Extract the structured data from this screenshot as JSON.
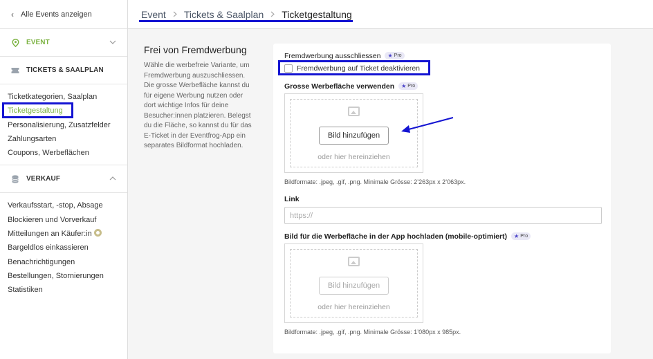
{
  "sidebar": {
    "back_label": "Alle Events anzeigen",
    "sections": {
      "event": {
        "label": "EVENT",
        "color": "#7cb342"
      },
      "tickets": {
        "label": "TICKETS & SAALPLAN",
        "items": [
          {
            "label": "Ticketkategorien, Saalplan"
          },
          {
            "label": "Ticketgestaltung",
            "active": true
          },
          {
            "label": "Personalisierung, Zusatzfelder"
          },
          {
            "label": "Zahlungsarten"
          },
          {
            "label": "Coupons, Werbeflächen"
          }
        ]
      },
      "verkauf": {
        "label": "VERKAUF",
        "items": [
          {
            "label": "Verkaufsstart, -stop, Absage"
          },
          {
            "label": "Blockieren und Vorverkauf"
          },
          {
            "label": "Mitteilungen an Käufer:in",
            "badge_icon": "pro-badge-icon"
          },
          {
            "label": "Bargeldlos einkassieren"
          },
          {
            "label": "Benachrichtigungen"
          },
          {
            "label": "Bestellungen, Stornierungen"
          },
          {
            "label": "Statistiken"
          }
        ]
      }
    }
  },
  "breadcrumb": {
    "items": [
      "Event",
      "Tickets & Saalplan",
      "Ticketgestaltung"
    ],
    "separator": ">"
  },
  "section": {
    "title": "Frei von Fremdwerbung",
    "description": "Wähle die werbefreie Variante, um Fremdwerbung auszuschliessen. Die grosse Werbefläche kannst du für eigene Werbung nutzen oder dort wichtige Infos für deine Besucher:innen platzieren. Belegst du die Fläche, so kannst du für das E-Ticket in der Eventfrog-App ein separates Bildformat hochladen."
  },
  "form": {
    "pro_label": "Pro",
    "exclude": {
      "label": "Fremdwerbung ausschliessen",
      "checkbox_label": "Fremdwerbung auf Ticket deaktivieren",
      "checked": false
    },
    "large_ad": {
      "label": "Grosse Werbefläche verwenden",
      "button_label": "Bild hinzufügen",
      "drop_hint": "oder hier hereinziehen",
      "formats_hint": "Bildformate: .jpeg, .gif, .png. Minimale Grösse: 2’263px x 2’063px."
    },
    "link": {
      "label": "Link",
      "placeholder": "https://",
      "value": ""
    },
    "app_ad": {
      "label": "Bild für die Werbefläche in der App hochladen (mobile-optimiert)",
      "button_label": "Bild hinzufügen",
      "drop_hint": "oder hier hereinziehen",
      "formats_hint": "Bildformate: .jpeg, .gif, .png. Minimale Grösse: 1’080px x 985px."
    }
  },
  "colors": {
    "accent_green": "#7cb342",
    "annotation_blue": "#1414d2",
    "pro_star": "#4a43c9"
  }
}
